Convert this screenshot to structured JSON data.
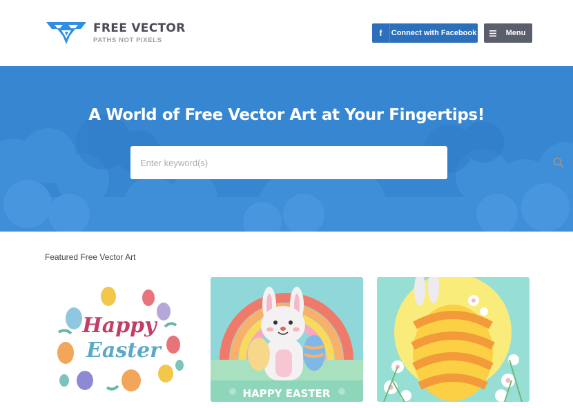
{
  "brand": {
    "title": "FREE VECTOR",
    "tagline": "PATHS NOT PIXELS",
    "logo_icon": "fv-logo-icon",
    "accent": "#2f8de4"
  },
  "header": {
    "facebook_icon_glyph": "f",
    "facebook_label": "Connect with Facebook",
    "facebook_color": "#2c6fbb",
    "menu_label": "Menu",
    "menu_color": "#5b5f6b"
  },
  "hero": {
    "title": "A World of Free Vector Art at Your Fingertips!",
    "background": "#3786d1",
    "search": {
      "placeholder": "Enter keyword(s)",
      "value": ""
    }
  },
  "featured": {
    "heading": "Featured Free Vector Art",
    "cards": [
      {
        "title_line1": "Happy",
        "title_line2": "Easter"
      },
      {
        "caption": "HAPPY EASTER"
      },
      {
        "caption": ""
      }
    ]
  }
}
